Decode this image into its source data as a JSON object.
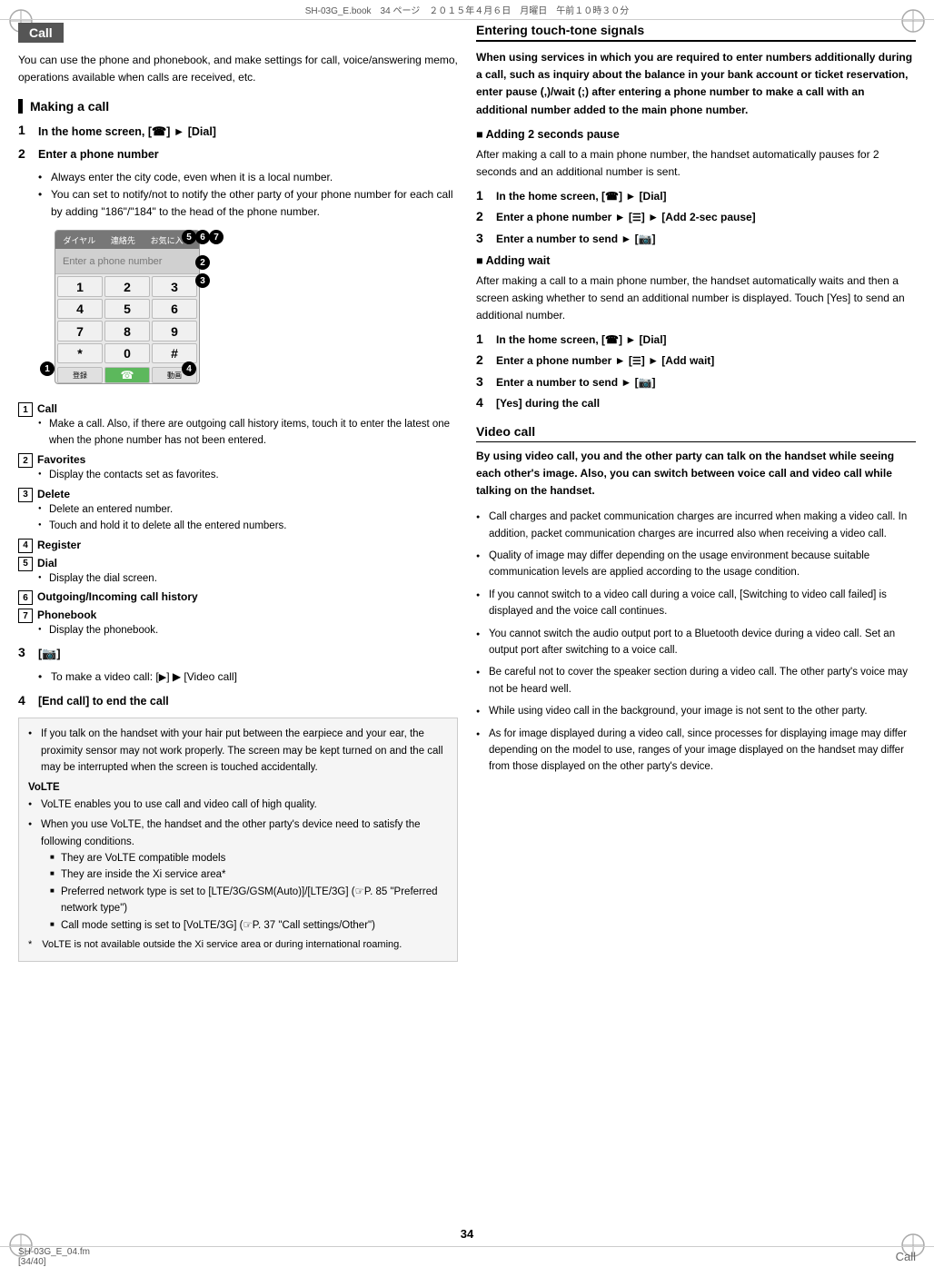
{
  "header": {
    "text": "SH-03G_E.book　34 ページ　２０１５年４月６日　月曜日　午前１０時３０分"
  },
  "footer": {
    "left": "SH-03G_E_04.fm",
    "left2": "[34/40]",
    "right": "34"
  },
  "left_col": {
    "title": "Call",
    "intro": "You can use the phone and phonebook, and make settings for call, voice/answering memo, operations available when calls are received, etc.",
    "making_call": {
      "heading": "Making a call",
      "step1": "In the home screen, [",
      "step1b": "] ▶ [Dial]",
      "step2": "Enter a phone number",
      "step2_bullets": [
        "Always enter the city code, even when it is a local number.",
        "You can set to notify/not to notify the other party of your phone number for each call by adding \"186\"/\"184\" to the head of the phone number."
      ],
      "phone_keys": [
        "1",
        "2",
        "3",
        "4",
        "5",
        "6",
        "7",
        "8",
        "9",
        "*",
        "0",
        "#"
      ],
      "phone_tabs": [
        "ダイヤル",
        "連絡先",
        "お気に入り"
      ],
      "badge_labels": [
        "1",
        "2",
        "3",
        "4",
        "5",
        "6",
        "7"
      ],
      "annotations": [
        {
          "num": "1",
          "title": "Call",
          "bullets": [
            "Make a call. Also, if there are outgoing call history items, touch it to enter the latest one when the phone number has not been entered."
          ]
        },
        {
          "num": "2",
          "title": "Favorites",
          "bullets": [
            "Display the contacts set as favorites."
          ]
        },
        {
          "num": "3",
          "title": "Delete",
          "bullets": [
            "Delete an entered number.",
            "Touch and hold it to delete all the entered numbers."
          ]
        },
        {
          "num": "4",
          "title": "Register"
        },
        {
          "num": "5",
          "title": "Dial",
          "bullets": [
            "Display the dial screen."
          ]
        },
        {
          "num": "6",
          "title": "Outgoing/Incoming call history"
        },
        {
          "num": "7",
          "title": "Phonebook",
          "bullets": [
            "Display the phonebook."
          ]
        }
      ],
      "step3_text": "[",
      "step3b": "]",
      "step3_note": "• To make a video call: [",
      "step3_note2": "] ▶ [Video call]",
      "step4": "[End call] to end the call"
    },
    "notice": {
      "main_bullet": "If you talk on the handset with your hair put between the earpiece and your ear, the proximity sensor may not work properly. The screen may be kept turned on and the call may be interrupted when the screen is touched accidentally.",
      "volte_label": "VoLTE",
      "volte_bullets": [
        "VoLTE enables you to use call and video call of high quality.",
        "When you use VoLTE, the handset and the other party's device need to satisfy the following conditions.",
        "They are VoLTE compatible models",
        "They are inside the Xi service area*",
        "Preferred network type is set to [LTE/3G/GSM(Auto)]/[LTE/3G] (☞P. 85 \"Preferred network type\")",
        "Call mode setting is set to [VoLTE/3G] (☞P. 37 \"Call settings/Other\")"
      ],
      "asterisk_note": "*　VoLTE is not available outside the Xi service area or during international roaming."
    }
  },
  "right_col": {
    "entering_title": "Entering touch-tone signals",
    "entering_intro": "When using services in which you are required to enter numbers additionally during a call, such as inquiry about the balance in your bank account or ticket reservation, enter pause (,)/wait (;) after entering a phone number to make a call with an additional number added to the main phone number.",
    "adding2sec": {
      "title": "Adding 2 seconds pause",
      "desc": "After making a call to a main phone number, the handset automatically pauses for 2 seconds and an additional number is sent.",
      "step1": "In the home screen, [",
      "step1b": "] ▶ [Dial]",
      "step2": "Enter a phone number",
      "step2b": " ▶ [",
      "step2c": "] ▶ [Add 2-sec pause]",
      "step3": "Enter a number to send ▶ [",
      "step3b": "]"
    },
    "adding_wait": {
      "title": "Adding wait",
      "desc": "After making a call to a main phone number, the handset automatically waits and then a screen asking whether to send an additional number is displayed. Touch [Yes] to send an additional number.",
      "step1": "In the home screen, [",
      "step1b": "] ▶ [Dial]",
      "step2": "Enter a phone number",
      "step2b": " ▶ [",
      "step2c": "] ▶ [Add wait]",
      "step3": "Enter a number to send ▶ [",
      "step3b": "]",
      "step4": "[Yes] during the call"
    },
    "video_call": {
      "title": "Video call",
      "intro": "By using video call, you and the other party can talk on the handset while seeing each other's image. Also, you can switch between voice call and video call while talking on the handset.",
      "bullets": [
        "Call charges and packet communication charges are incurred when making a video call. In addition, packet communication charges are incurred also when receiving a video call.",
        "Quality of image may differ depending on the usage environment because suitable communication levels are applied according to the usage condition.",
        "If you cannot switch to a video call during a voice call, [Switching to video call failed] is displayed and the voice call continues.",
        "You cannot switch the audio output port to a Bluetooth device during a video call. Set an output port after switching to a voice call.",
        "Be careful not to cover the speaker section during a video call. The other party's voice may not be heard well.",
        "While using video call in the background, your image is not sent to the other party.",
        "As for image displayed during a video call, since processes for displaying image may differ depending on the model to use, ranges of your image displayed on the handset may differ from those displayed on the other party's device."
      ]
    }
  },
  "page_number": "34",
  "right_label": "Call"
}
